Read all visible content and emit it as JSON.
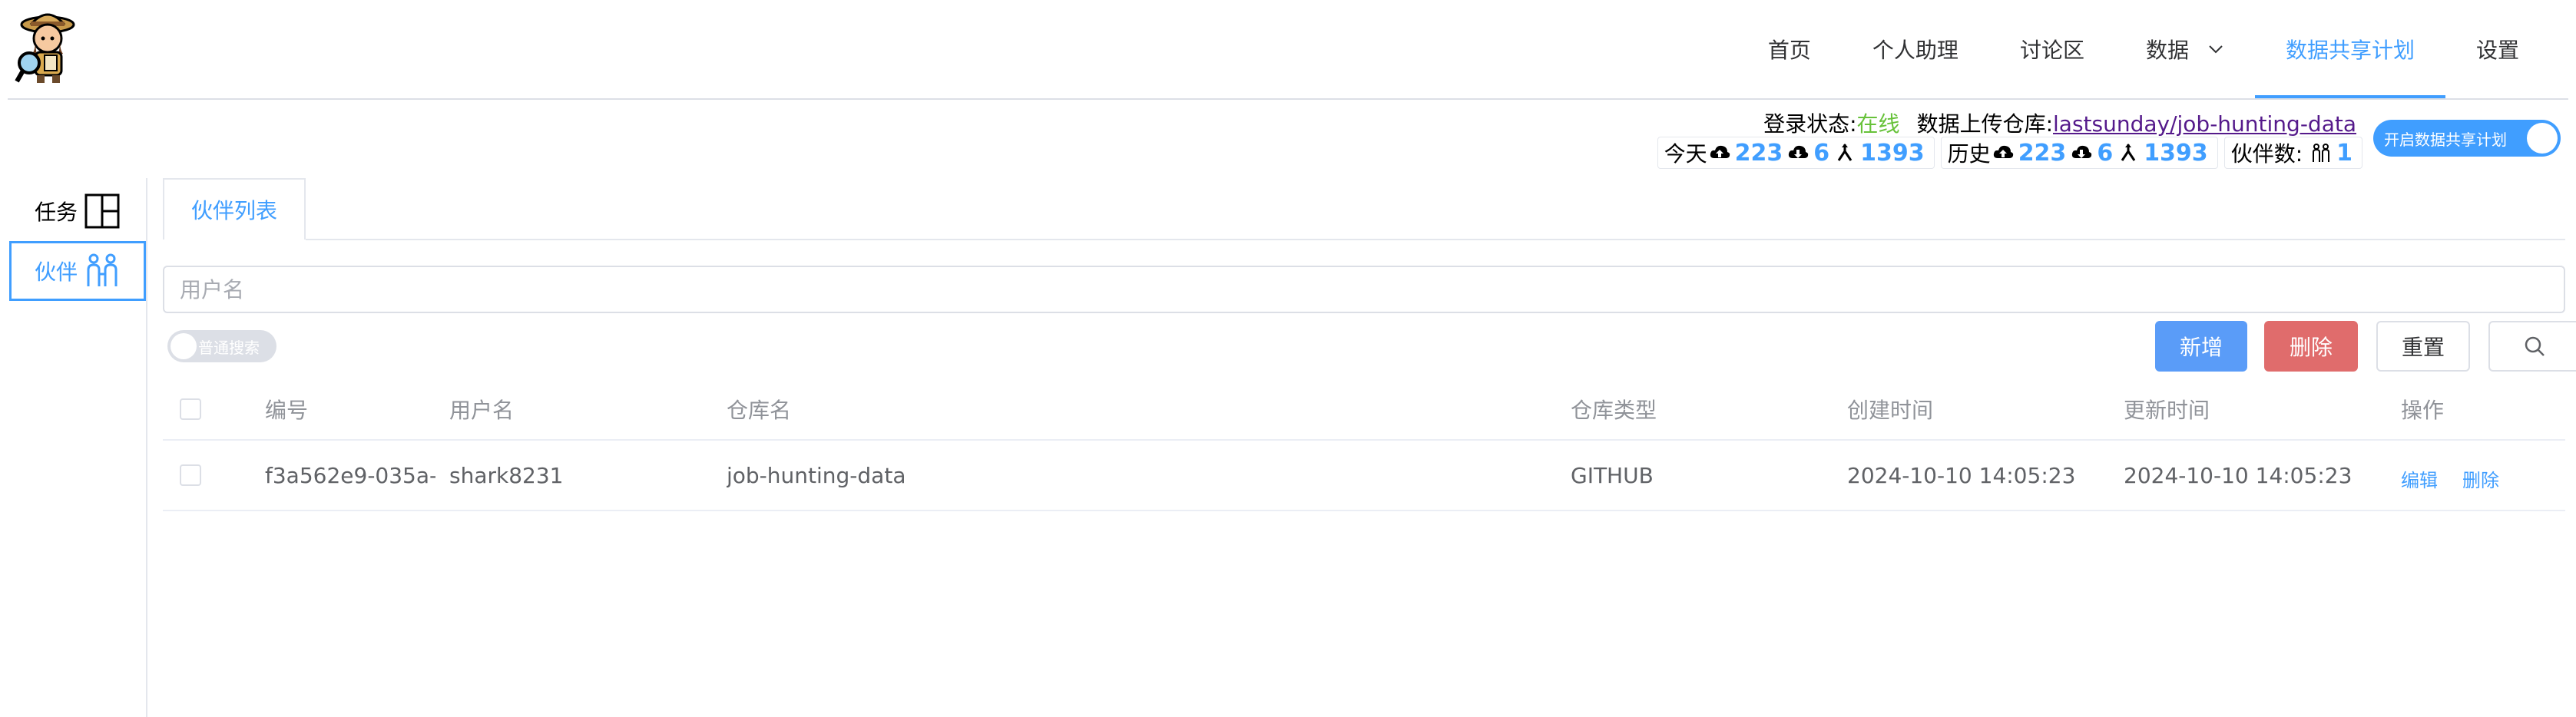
{
  "nav": {
    "items": [
      {
        "label": "首页"
      },
      {
        "label": "个人助理"
      },
      {
        "label": "讨论区"
      },
      {
        "label": "数据"
      },
      {
        "label": "数据共享计划"
      },
      {
        "label": "设置"
      }
    ],
    "active_index": 4
  },
  "status": {
    "login_label": "登录状态:",
    "login_value": "在线",
    "repo_label": "数据上传仓库:",
    "repo_link": "lastsunday/job-hunting-data"
  },
  "stats": {
    "today": {
      "label": "今天",
      "upload": "223",
      "download": "6",
      "merge": "1393"
    },
    "history": {
      "label": "历史",
      "upload": "223",
      "download": "6",
      "merge": "1393"
    },
    "partners": {
      "label": "伙伴数:",
      "count": "1"
    }
  },
  "share_switch": {
    "label": "开启数据共享计划",
    "on": true
  },
  "sidebar": {
    "items": [
      {
        "label": "任务",
        "icon": "layout-icon"
      },
      {
        "label": "伙伴",
        "icon": "partners-icon"
      }
    ],
    "active_index": 1
  },
  "tabs": [
    {
      "label": "伙伴列表"
    }
  ],
  "search": {
    "placeholder": "用户名",
    "value": ""
  },
  "mode_switch": {
    "label": "普通搜索",
    "on": false
  },
  "toolbar": {
    "add_label": "新增",
    "delete_label": "删除",
    "reset_label": "重置"
  },
  "table": {
    "columns": [
      "编号",
      "用户名",
      "仓库名",
      "仓库类型",
      "创建时间",
      "更新时间",
      "操作"
    ],
    "rows": [
      {
        "id": "f3a562e9-035a-",
        "username": "shark8231",
        "repo": "job-hunting-data",
        "type": "GITHUB",
        "created": "2024-10-10 14:05:23",
        "updated": "2024-10-10 14:05:23",
        "actions": [
          "编辑",
          "删除"
        ]
      }
    ]
  },
  "colors": {
    "primary": "#409eff",
    "danger": "#e06c6c",
    "online": "#67c23a",
    "repo_link": "#551a8b"
  }
}
